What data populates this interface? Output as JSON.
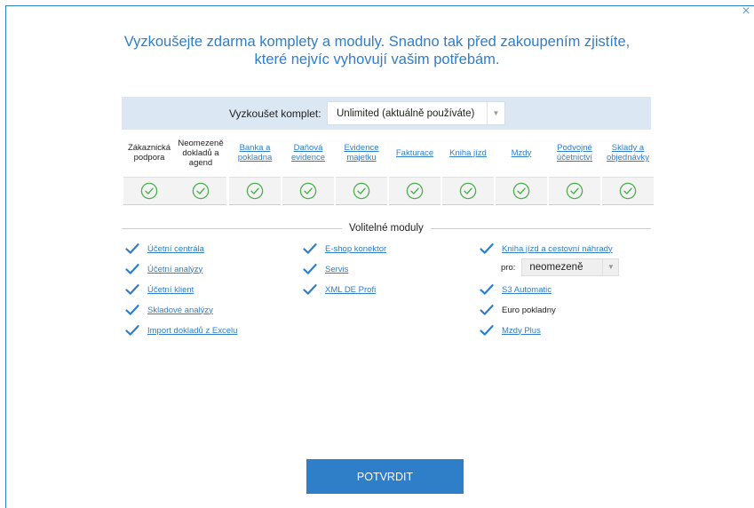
{
  "dialog": {
    "close_glyph": "×",
    "headline_line1": "Vyzkoušejte zdarma komplety a moduly. Snadno tak před zakoupením zjistíte,",
    "headline_line2": "které nejvíc vyhovují vašim potřebám."
  },
  "kit_select": {
    "label": "Vyzkoušet komplet:",
    "value": "Unlimited (aktuálně používáte)",
    "arrow_icon": "triangle-down"
  },
  "kit_features": [
    {
      "line1": "Zákaznická",
      "line2": "podpora",
      "line3": "",
      "link": false
    },
    {
      "line1": "Neomezeně",
      "line2": "dokladů a",
      "line3": "agend",
      "link": false
    },
    {
      "line1": "Banka a",
      "line2": "pokladna",
      "line3": "",
      "link": true
    },
    {
      "line1": "Daňová",
      "line2": "evidence",
      "line3": "",
      "link": true
    },
    {
      "line1": "Evidence",
      "line2": "majetku",
      "line3": "",
      "link": true
    },
    {
      "line1": "Fakturace",
      "line2": "",
      "line3": "",
      "link": true
    },
    {
      "line1": "Kniha jízd",
      "line2": "",
      "line3": "",
      "link": true
    },
    {
      "line1": "Mzdy",
      "line2": "",
      "line3": "",
      "link": true
    },
    {
      "line1": "Podvojné",
      "line2": "účetnictví",
      "line3": "",
      "link": true
    },
    {
      "line1": "Sklady a",
      "line2": "objednávky",
      "line3": "",
      "link": true
    }
  ],
  "optional_modules_title": "Volitelné moduly",
  "modules": {
    "col1": [
      {
        "label": "Účetní centrála",
        "checked": true,
        "link": true
      },
      {
        "label": "Účetní analýzy",
        "checked": true,
        "link": true
      },
      {
        "label": "Účetní klient",
        "checked": true,
        "link": true
      },
      {
        "label": "Skladové analýzy",
        "checked": true,
        "link": true
      },
      {
        "label": "Import dokladů z Excelu",
        "checked": true,
        "link": true
      }
    ],
    "col2": [
      {
        "label": "E-shop konektor",
        "checked": true,
        "link": true
      },
      {
        "label": "Servis",
        "checked": true,
        "link": true
      },
      {
        "label": "XML DE Profi",
        "checked": true,
        "link": true
      }
    ],
    "col3": [
      {
        "label": "Kniha jízd a cestovní náhrady",
        "checked": true,
        "link": true
      },
      {
        "label": "S3 Automatic",
        "checked": true,
        "link": true
      },
      {
        "label": "Euro pokladny",
        "checked": true,
        "link": false
      },
      {
        "label": "Mzdy Plus",
        "checked": true,
        "link": true
      }
    ]
  },
  "pro_select": {
    "label": "pro:",
    "value": "neomezeně"
  },
  "confirm_button": "POTVRDIT",
  "colors": {
    "accent": "#2f7ec8",
    "check_green": "#4caf50",
    "check_blue": "#2f7ec8",
    "bar_bg": "#dbe7f3"
  }
}
